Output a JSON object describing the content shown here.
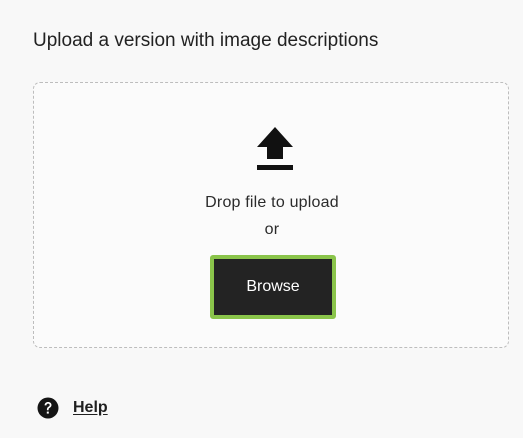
{
  "section": {
    "title": "Upload a version with image descriptions"
  },
  "dropzone": {
    "icon": "upload-arrow-icon",
    "line1": "Drop file to upload",
    "line2": "or",
    "browse_label": "Browse"
  },
  "help": {
    "icon": "question-circle-icon",
    "label": "Help"
  },
  "colors": {
    "background": "#f8f8f8",
    "button_bg": "#232323",
    "button_focus_ring": "#8ac44a",
    "text": "#222222"
  }
}
